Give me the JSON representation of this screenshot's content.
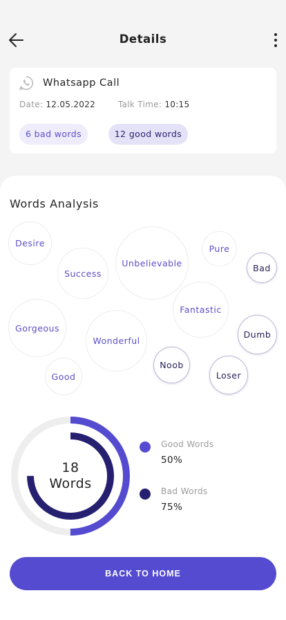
{
  "header": {
    "title": "Details",
    "back_icon": "arrow-left-icon",
    "menu_icon": "more-vertical-icon"
  },
  "call": {
    "icon": "whatsapp-icon",
    "title": "Whatsapp Call",
    "date_label": "Date:",
    "date": "12.05.2022",
    "talk_time_label": "Talk Time:",
    "talk_time": "10:15",
    "bad_chip": "6 bad words",
    "good_chip": "12 good words"
  },
  "analysis": {
    "title": "Words Analysis",
    "words": [
      {
        "text": "Desire",
        "type": "good"
      },
      {
        "text": "Success",
        "type": "good"
      },
      {
        "text": "Unbelievable",
        "type": "good"
      },
      {
        "text": "Pure",
        "type": "good"
      },
      {
        "text": "Bad",
        "type": "bad"
      },
      {
        "text": "Gorgeous",
        "type": "good"
      },
      {
        "text": "Wonderful",
        "type": "good"
      },
      {
        "text": "Fantastic",
        "type": "good"
      },
      {
        "text": "Dumb",
        "type": "bad"
      },
      {
        "text": "Noob",
        "type": "bad"
      },
      {
        "text": "Loser",
        "type": "bad"
      },
      {
        "text": "Good",
        "type": "good"
      }
    ]
  },
  "summary": {
    "count": "18",
    "unit": "Words",
    "good_label": "Good Words",
    "good_value": "50%",
    "good_fraction": 0.5,
    "bad_label": "Bad Words",
    "bad_value": "75%",
    "bad_fraction": 0.75
  },
  "colors": {
    "good": "#554bd0",
    "bad": "#262070",
    "track": "#eeeeee"
  },
  "actions": {
    "back_home": "BACK TO HOME"
  }
}
